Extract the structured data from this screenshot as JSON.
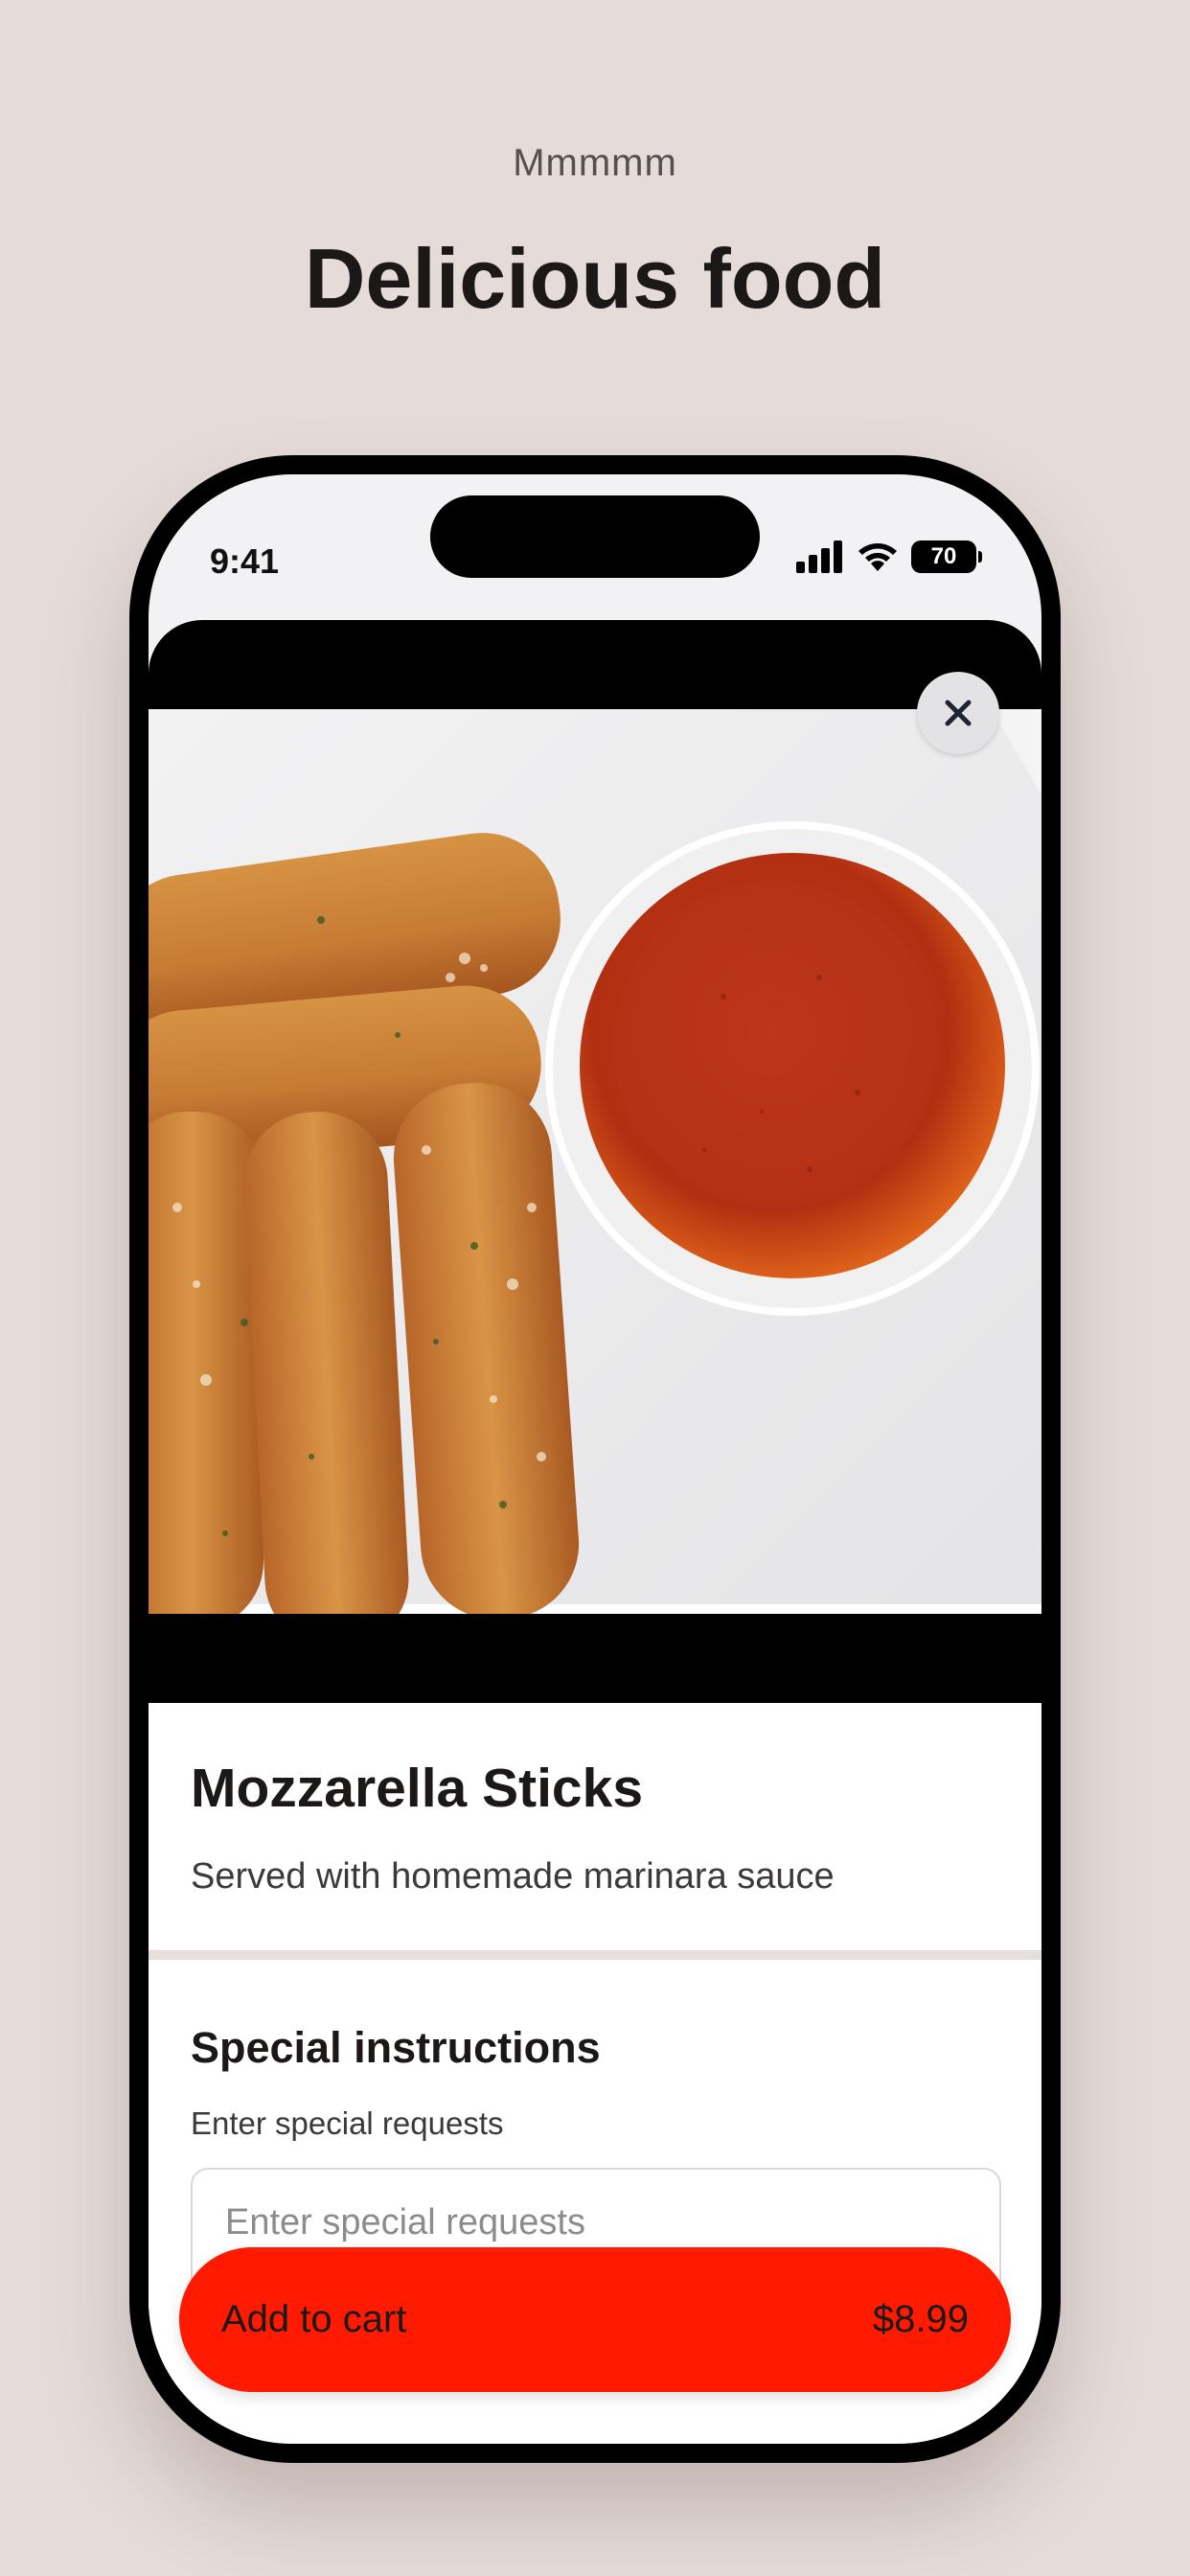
{
  "header": {
    "eyebrow": "Mmmmm",
    "title": "Delicious food"
  },
  "status_bar": {
    "time": "9:41",
    "battery": "70",
    "icons": [
      "signal-icon",
      "wifi-icon",
      "battery-icon"
    ]
  },
  "item": {
    "image_alt_icon": "food-photo",
    "close_icon": "close-icon",
    "name": "Mozzarella Sticks",
    "description": "Served with homemade marinara sauce"
  },
  "special_instructions": {
    "title": "Special instructions",
    "label": "Enter special requests",
    "placeholder": "Enter special requests",
    "value": ""
  },
  "cart": {
    "button_label": "Add to cart",
    "price": "$8.99"
  },
  "colors": {
    "background": "#e5dcd9",
    "accent": "#ff1a00",
    "text": "#1b1817"
  }
}
